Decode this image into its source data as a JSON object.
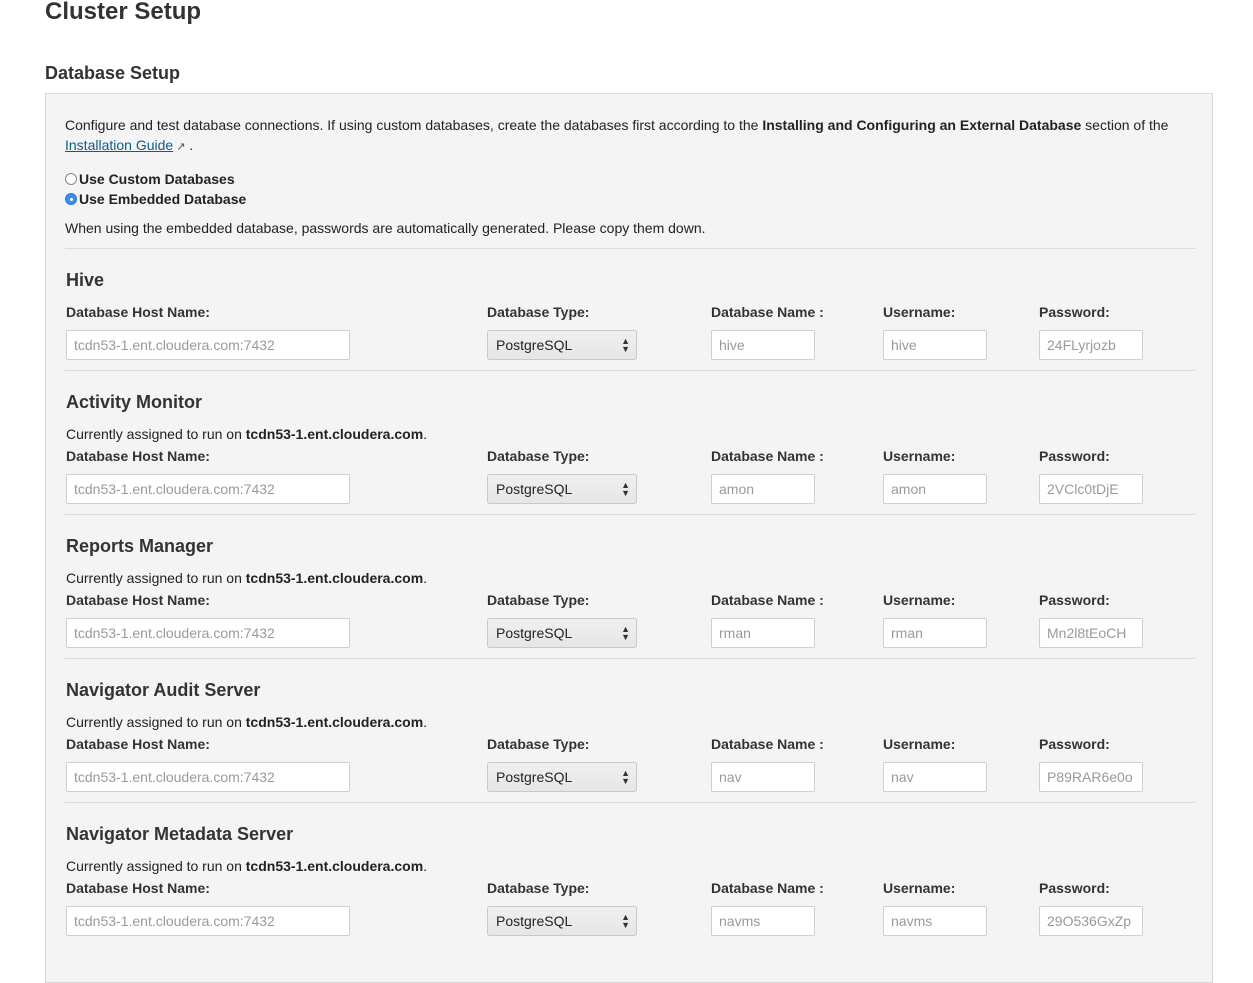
{
  "page_title": "Cluster Setup",
  "section_title": "Database Setup",
  "intro": {
    "text_before": "Configure and test database connections. If using custom databases, create the databases first according to the ",
    "bold": "Installing and Configuring an External Database",
    "text_after": " section of the",
    "link_label": "Installation Guide",
    "link_icon": "external-link-icon",
    "trailing": " ."
  },
  "radio_options": [
    {
      "label": "Use Custom Databases",
      "checked": false
    },
    {
      "label": "Use Embedded Database",
      "checked": true
    }
  ],
  "embedded_note": "When using the embedded database, passwords are automatically generated. Please copy them down.",
  "field_labels": {
    "host": "Database Host Name:",
    "type": "Database Type:",
    "name": "Database Name :",
    "user": "Username:",
    "password": "Password:"
  },
  "assigned_prefix": "Currently assigned to run on ",
  "assigned_suffix": ".",
  "select_icon": "select-updown-icon",
  "services": [
    {
      "title": "Hive",
      "assigned_host": "",
      "host": "tcdn53-1.ent.cloudera.com:7432",
      "type": "PostgreSQL",
      "db_name": "hive",
      "username": "hive",
      "password": "24FLyrjozb"
    },
    {
      "title": "Activity Monitor",
      "assigned_host": "tcdn53-1.ent.cloudera.com",
      "host": "tcdn53-1.ent.cloudera.com:7432",
      "type": "PostgreSQL",
      "db_name": "amon",
      "username": "amon",
      "password": "2VClc0tDjE"
    },
    {
      "title": "Reports Manager",
      "assigned_host": "tcdn53-1.ent.cloudera.com",
      "host": "tcdn53-1.ent.cloudera.com:7432",
      "type": "PostgreSQL",
      "db_name": "rman",
      "username": "rman",
      "password": "Mn2l8tEoCH"
    },
    {
      "title": "Navigator Audit Server",
      "assigned_host": "tcdn53-1.ent.cloudera.com",
      "host": "tcdn53-1.ent.cloudera.com:7432",
      "type": "PostgreSQL",
      "db_name": "nav",
      "username": "nav",
      "password": "P89RAR6e0o"
    },
    {
      "title": "Navigator Metadata Server",
      "assigned_host": "tcdn53-1.ent.cloudera.com",
      "host": "tcdn53-1.ent.cloudera.com:7432",
      "type": "PostgreSQL",
      "db_name": "navms",
      "username": "navms",
      "password": "29O536GxZp"
    }
  ]
}
